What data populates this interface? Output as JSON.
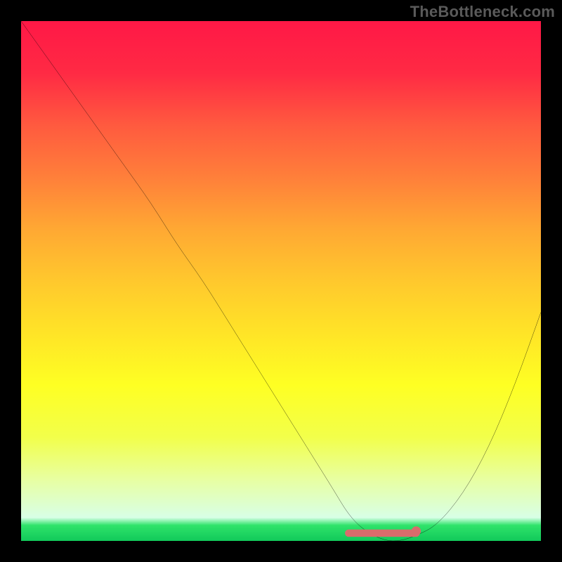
{
  "watermark": "TheBottleneck.com",
  "chart_data": {
    "type": "line",
    "title": "",
    "xlabel": "",
    "ylabel": "",
    "xlim": [
      0,
      100
    ],
    "ylim": [
      0,
      100
    ],
    "series": [
      {
        "name": "bottleneck-curve",
        "x": [
          0,
          5,
          10,
          15,
          20,
          25,
          30,
          35,
          40,
          45,
          50,
          55,
          60,
          63,
          66,
          70,
          73,
          76,
          80,
          85,
          90,
          95,
          100
        ],
        "values": [
          100,
          93,
          86,
          79,
          72,
          65,
          57,
          50,
          42,
          34,
          26,
          18,
          10,
          5,
          2,
          0,
          0,
          1,
          3,
          9,
          18,
          30,
          44
        ]
      }
    ],
    "highlight": {
      "name": "optimal-zone",
      "x_start": 63,
      "x_end": 76,
      "y": 1.5,
      "color": "#d96c6c"
    },
    "background_gradient": {
      "top": "#ff1846",
      "bottom": "#11c95a"
    }
  }
}
